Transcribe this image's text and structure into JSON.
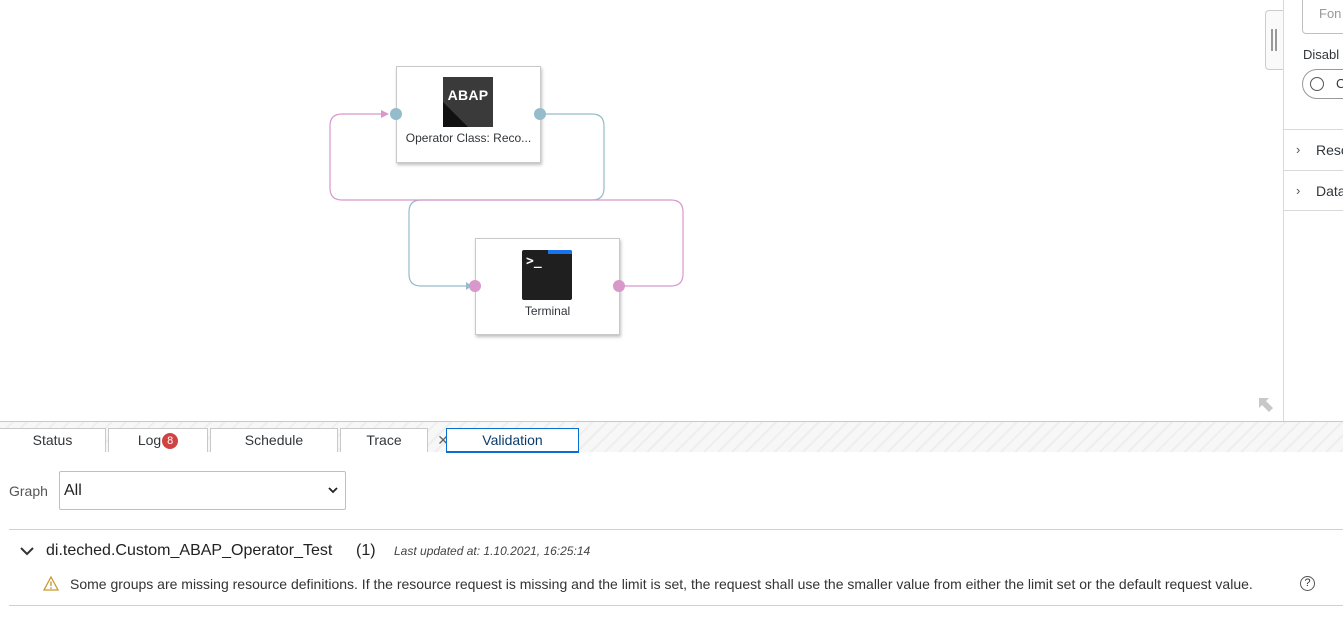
{
  "graph": {
    "nodes": {
      "abap": {
        "icon": "abap-icon",
        "icon_text": "ABAP",
        "label": "Operator Class: Reco..."
      },
      "terminal": {
        "icon": "terminal-icon",
        "icon_text": ">_",
        "label": "Terminal"
      }
    },
    "colors": {
      "input_port": "#94bccb",
      "output_port": "#d898cc",
      "edge_blue": "#94bccb",
      "edge_pink": "#d898cc"
    }
  },
  "right_panel": {
    "font_placeholder": "Fon",
    "disable_label": "Disabl",
    "radio_label": "C",
    "sections": [
      "Reso",
      "Data"
    ]
  },
  "bottom_tabs": [
    {
      "label": "Status"
    },
    {
      "label": "Log",
      "badge": "8"
    },
    {
      "label": "Schedule"
    },
    {
      "label": "Trace"
    },
    {
      "label": "Validation",
      "active": true
    }
  ],
  "validation": {
    "graph_filter_label": "Graph",
    "graph_filter_value": "All",
    "group_title": "di.teched.Custom_ABAP_Operator_Test",
    "group_count": "(1)",
    "last_updated": "Last updated at: 1.10.2021, 16:25:14",
    "message": "Some groups are missing resource definitions. If the resource request is missing and the limit is set, the request shall use the smaller value from either the limit set or the default request value.",
    "help": "?"
  }
}
